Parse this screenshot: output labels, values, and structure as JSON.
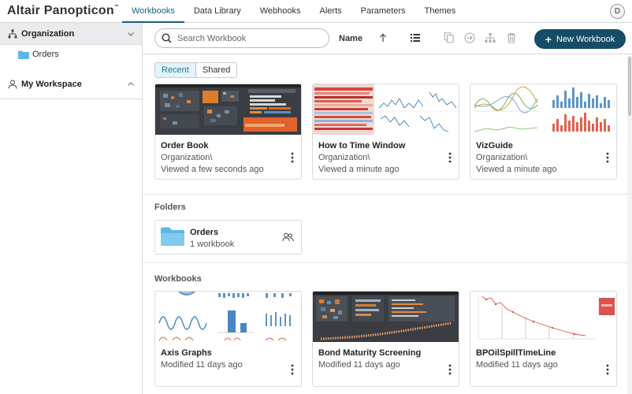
{
  "app": {
    "title": "Altair Panopticon",
    "trademark": "™",
    "user_initial": "D"
  },
  "nav": {
    "tabs": [
      {
        "label": "Workbooks",
        "active": true
      },
      {
        "label": "Data Library",
        "active": false
      },
      {
        "label": "Webhooks",
        "active": false
      },
      {
        "label": "Alerts",
        "active": false
      },
      {
        "label": "Parameters",
        "active": false
      },
      {
        "label": "Themes",
        "active": false
      }
    ]
  },
  "sidebar": {
    "organization_label": "Organization",
    "folders": [
      {
        "label": "Orders"
      }
    ],
    "workspace_label": "My Workspace"
  },
  "toolbar": {
    "search_placeholder": "Search Workbook",
    "sort_label": "Name",
    "new_workbook_label": "New Workbook",
    "icons": [
      "sort-arrow-up-icon",
      "list-view-icon",
      "copy-icon",
      "move-icon",
      "hierarchy-icon",
      "trash-icon"
    ]
  },
  "filter": {
    "recent_label": "Recent",
    "shared_label": "Shared",
    "selected": "Recent"
  },
  "recent": [
    {
      "title": "Order Book",
      "path": "Organization\\",
      "time": "Viewed a few seconds ago"
    },
    {
      "title": "How to Time Window",
      "path": "Organization\\",
      "time": "Viewed a minute ago"
    },
    {
      "title": "VizGuide",
      "path": "Organization\\",
      "time": "Viewed a minute ago"
    }
  ],
  "folders_section": {
    "heading": "Folders",
    "items": [
      {
        "name": "Orders",
        "count": "1 workbook"
      }
    ]
  },
  "workbooks_section": {
    "heading": "Workbooks",
    "items": [
      {
        "title": "Axis Graphs",
        "time": "Modified 11 days ago"
      },
      {
        "title": "Bond Maturity Screening",
        "time": "Modified 11 days ago"
      },
      {
        "title": "BPOilSpillTimeLine",
        "time": "Modified 11 days ago"
      }
    ]
  },
  "colors": {
    "accent": "#164d66",
    "tab_active": "#1b5d84",
    "folder": "#5bb8e6"
  }
}
